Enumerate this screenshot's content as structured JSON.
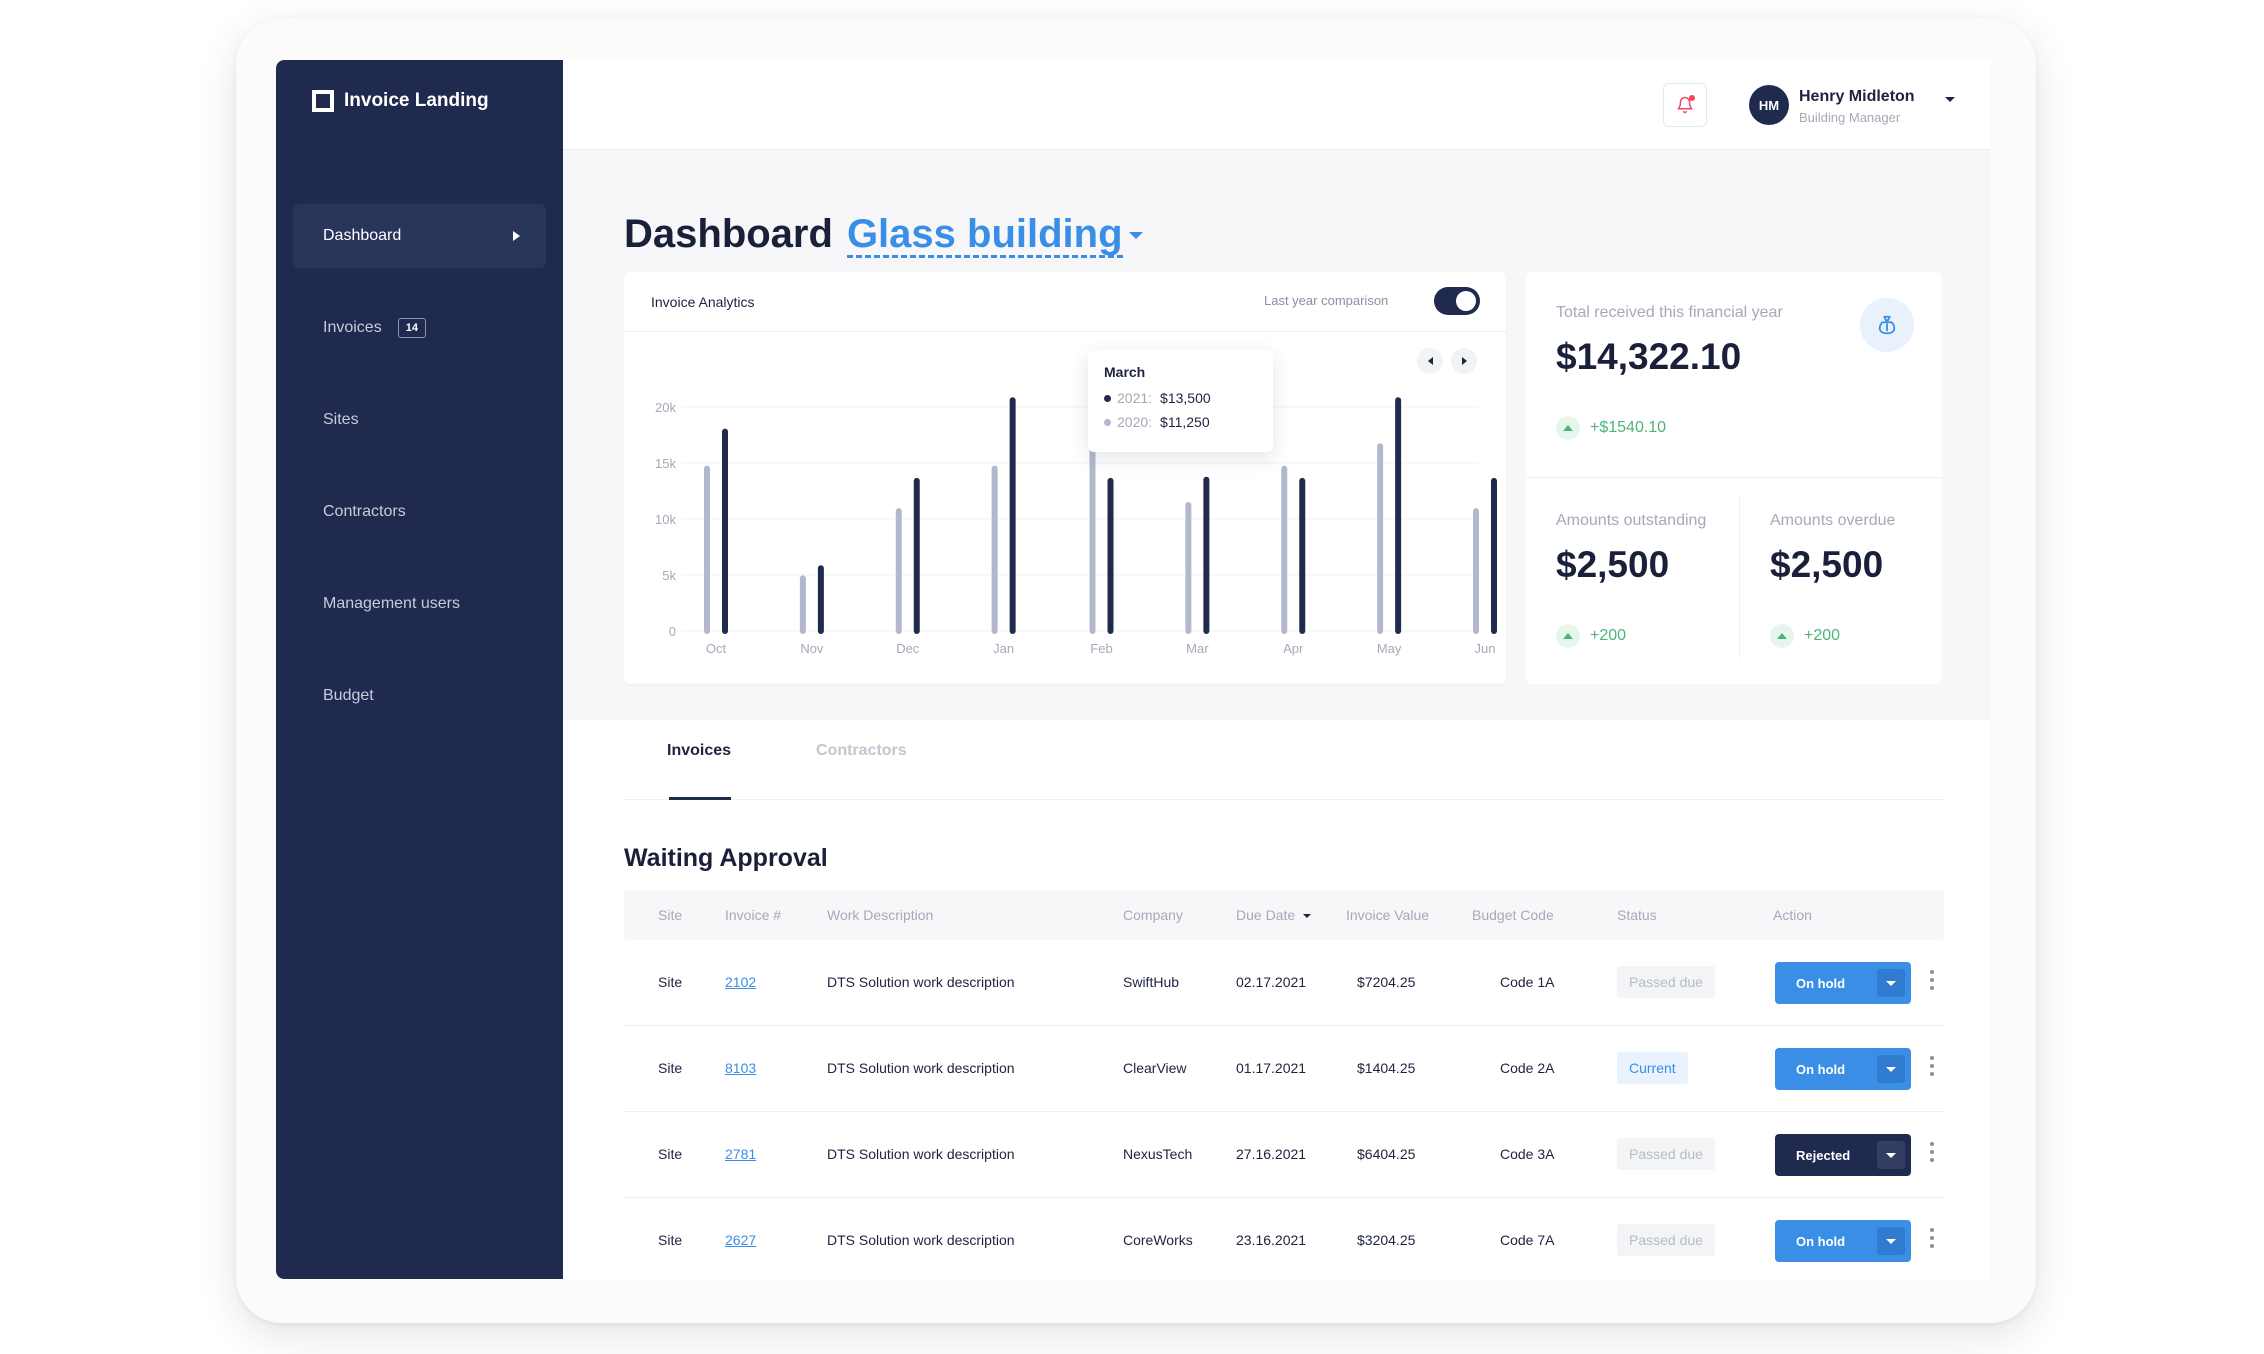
{
  "app": {
    "name": "Invoice Landing"
  },
  "sidebar": {
    "items": [
      {
        "label": "Dashboard",
        "active": true
      },
      {
        "label": "Invoices",
        "badge": "14"
      },
      {
        "label": "Sites"
      },
      {
        "label": "Contractors"
      },
      {
        "label": "Management users"
      },
      {
        "label": "Budget"
      }
    ]
  },
  "header": {
    "user": {
      "initials": "HM",
      "name": "Henry Midleton",
      "role": "Building Manager"
    },
    "icons": [
      "bell-icon"
    ]
  },
  "page": {
    "title": "Dashboard",
    "building": "Glass building"
  },
  "analytics": {
    "title": "Invoice Analytics",
    "comparison_label": "Last year comparison",
    "comparison_enabled": true,
    "tooltip": {
      "month": "March",
      "rows": [
        {
          "label": "2021:",
          "value": "$13,500"
        },
        {
          "label": "2020:",
          "value": "$11,250"
        }
      ]
    }
  },
  "chart_data": {
    "type": "bar",
    "title": "Invoice Analytics",
    "categories": [
      "Oct",
      "Nov",
      "Dec",
      "Jan",
      "Feb",
      "Mar",
      "Apr",
      "May",
      "Jun"
    ],
    "yticks": [
      "0",
      "5k",
      "10k",
      "15k",
      "20k"
    ],
    "ylim": [
      0,
      20000
    ],
    "series": [
      {
        "name": "2020",
        "color": "#b3b7cc",
        "values": [
          14500,
          4700,
          10700,
          14500,
          16500,
          11250,
          14500,
          16500,
          10700
        ]
      },
      {
        "name": "2021",
        "color": "#202a4e",
        "values": [
          17800,
          5600,
          13400,
          20600,
          13400,
          13500,
          13400,
          20600,
          13400
        ]
      }
    ]
  },
  "stats": {
    "total": {
      "label": "Total received this financial year",
      "value": "$14,322.10",
      "delta": "+$1540.10"
    },
    "outstanding": {
      "label": "Amounts outstanding",
      "value": "$2,500",
      "delta": "+200"
    },
    "overdue": {
      "label": "Amounts overdue",
      "value": "$2,500",
      "delta": "+200"
    }
  },
  "tabs": [
    {
      "label": "Invoices",
      "active": true
    },
    {
      "label": "Contractors",
      "active": false
    }
  ],
  "waiting": {
    "title": "Waiting Approval",
    "columns": [
      "Site",
      "Invoice #",
      "Work Description",
      "Company",
      "Due Date",
      "Invoice Value",
      "Budget Code",
      "Status",
      "Action"
    ],
    "rows": [
      {
        "site": "Site",
        "invoice": "2102",
        "desc": "DTS Solution work description",
        "company": "SwiftHub",
        "due": "02.17.2021",
        "value": "$7204.25",
        "code": "Code 1A",
        "status": "Passed due",
        "action": "On hold"
      },
      {
        "site": "Site",
        "invoice": "8103",
        "desc": "DTS Solution work description",
        "company": "ClearView",
        "due": "01.17.2021",
        "value": "$1404.25",
        "code": "Code 2A",
        "status": "Current",
        "action": "On hold"
      },
      {
        "site": "Site",
        "invoice": "2781",
        "desc": "DTS Solution work description",
        "company": "NexusTech",
        "due": "27.16.2021",
        "value": "$6404.25",
        "code": "Code 3A",
        "status": "Passed due",
        "action": "Rejected"
      },
      {
        "site": "Site",
        "invoice": "2627",
        "desc": "DTS Solution work description",
        "company": "CoreWorks",
        "due": "23.16.2021",
        "value": "$3204.25",
        "code": "Code 7A",
        "status": "Passed due",
        "action": "On hold"
      }
    ]
  }
}
